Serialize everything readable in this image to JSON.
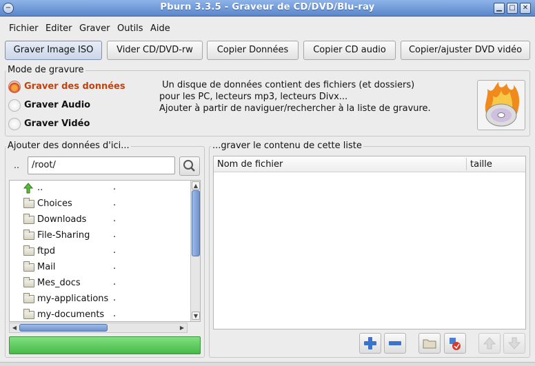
{
  "window": {
    "title": "Pburn 3.3.5 - Graveur de CD/DVD/Blu-ray"
  },
  "menu": [
    "Fichier",
    "Editer",
    "Graver",
    "Outils",
    "Aide"
  ],
  "toolbar": [
    "Graver Image ISO",
    "Vider CD/DVD-rw",
    "Copier Données",
    "Copier CD audio",
    "Copier/ajuster DVD vidéo"
  ],
  "mode": {
    "label": "Mode de gravure",
    "options": [
      "Graver des données",
      "Graver Audio",
      "Graver Vidéo"
    ],
    "selected": "Graver des données",
    "description": [
      " Un disque de données contient des fichiers (et dossiers)",
      "pour les PC, lecteurs mp3, lecteurs Divx...",
      "Ajouter à partir de naviguer/rechercher à la liste de gravure."
    ]
  },
  "browser": {
    "label": "Ajouter des données d'ici...",
    "up_label": "..",
    "path": "/root/",
    "files": [
      {
        "name": "..",
        "size": "."
      },
      {
        "name": "Choices",
        "size": "."
      },
      {
        "name": "Downloads",
        "size": "."
      },
      {
        "name": "File-Sharing",
        "size": "."
      },
      {
        "name": "ftpd",
        "size": "."
      },
      {
        "name": "Mail",
        "size": "."
      },
      {
        "name": "Mes_docs",
        "size": "."
      },
      {
        "name": "my-applications",
        "size": "."
      },
      {
        "name": "my-documents",
        "size": "."
      }
    ]
  },
  "burnlist": {
    "label": "...graver le contenu de cette liste",
    "columns": [
      "Nom de fichier",
      "taille"
    ]
  },
  "colors": {
    "accent": "#c2410c",
    "progress": "#57c957",
    "titlebar": "#6f97d6"
  },
  "icons": [
    "add-icon",
    "remove-icon",
    "folder-icon",
    "edit-icon",
    "arrow-up-icon",
    "arrow-down-icon"
  ]
}
